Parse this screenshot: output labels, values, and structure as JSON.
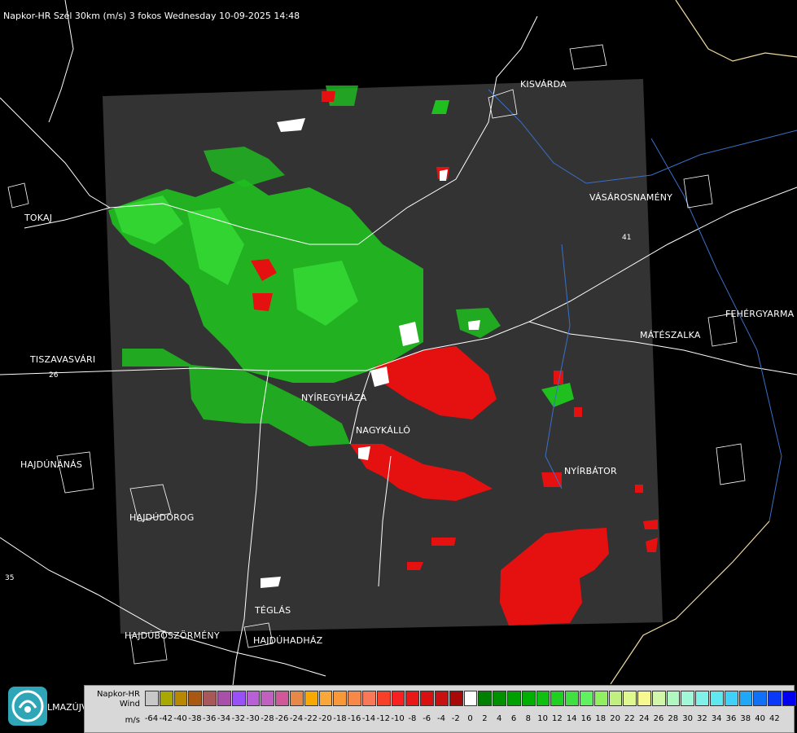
{
  "title": "Napkor-HR Szél 30km (m/s) 3 fokos Wednesday 10-09-2025 14:48",
  "cities": [
    {
      "id": "kisvarda",
      "name": "KISVÁRDA"
    },
    {
      "id": "vasarosnameny",
      "name": "VÁSÁROSNAMÉNY"
    },
    {
      "id": "tokaj",
      "name": "TOKAJ"
    },
    {
      "id": "fehergyarmat",
      "name": "FEHÉRGYARMA"
    },
    {
      "id": "mateszalka",
      "name": "MÁTÉSZALKA"
    },
    {
      "id": "tiszavasvari",
      "name": "TISZAVASVÁRI"
    },
    {
      "id": "nyiregyhaza",
      "name": "NYÍREGYHÁZA"
    },
    {
      "id": "nagykallo",
      "name": "NAGYKÁLLÓ"
    },
    {
      "id": "hajdunanas",
      "name": "HAJDÚNÁNÁS"
    },
    {
      "id": "nyirbator",
      "name": "NYÍRBÁTOR"
    },
    {
      "id": "hajdudorog",
      "name": "HAJDÚDOROG"
    },
    {
      "id": "teglas",
      "name": "TÉGLÁS"
    },
    {
      "id": "hajduboszormeny",
      "name": "HAJDÚBÖSZÖRMÉNY"
    },
    {
      "id": "hajduhadhaz",
      "name": "HAJDÚHADHÁZ"
    },
    {
      "id": "balmazujvaros",
      "name": "LMAZÚJVÁR"
    }
  ],
  "road_labels": [
    "26",
    "35",
    "41"
  ],
  "legend": {
    "name_line1": "Napkor-HR",
    "name_line2": "Wind",
    "unit": "m/s",
    "ticks": [
      "-64",
      "-42",
      "-40",
      "-38",
      "-36",
      "-34",
      "-32",
      "-30",
      "-28",
      "-26",
      "-24",
      "-22",
      "-20",
      "-18",
      "-16",
      "-14",
      "-12",
      "-10",
      "-8",
      "-6",
      "-4",
      "-2",
      "0",
      "2",
      "4",
      "6",
      "8",
      "10",
      "12",
      "14",
      "16",
      "18",
      "20",
      "22",
      "24",
      "26",
      "28",
      "30",
      "32",
      "34",
      "36",
      "38",
      "40",
      "42"
    ],
    "colors": [
      "#c8c8c8",
      "#a8a800",
      "#b88800",
      "#a85810",
      "#a85858",
      "#a850a8",
      "#9850f8",
      "#b860d8",
      "#c060c0",
      "#d05898",
      "#e88848",
      "#f8a800",
      "#f8a838",
      "#f89838",
      "#f88848",
      "#f87858",
      "#f84028",
      "#f82020",
      "#e81818",
      "#d81010",
      "#c81010",
      "#a80808",
      "#ffffff",
      "#008000",
      "#009000",
      "#00a000",
      "#00b000",
      "#10c010",
      "#20d020",
      "#40e040",
      "#60f060",
      "#90f060",
      "#c0f080",
      "#e0f890",
      "#f8f890",
      "#d0f8a8",
      "#b0f8c0",
      "#a0f8d8",
      "#80f0e8",
      "#60e8f0",
      "#40d0f8",
      "#20a8f8",
      "#1070f8",
      "#0838f8",
      "#0000f0"
    ]
  },
  "radar_colors": {
    "background": "#333333",
    "positive": "#20c020",
    "positive_light": "#30e030",
    "negative": "#e01010",
    "noise": "#ffffff"
  }
}
